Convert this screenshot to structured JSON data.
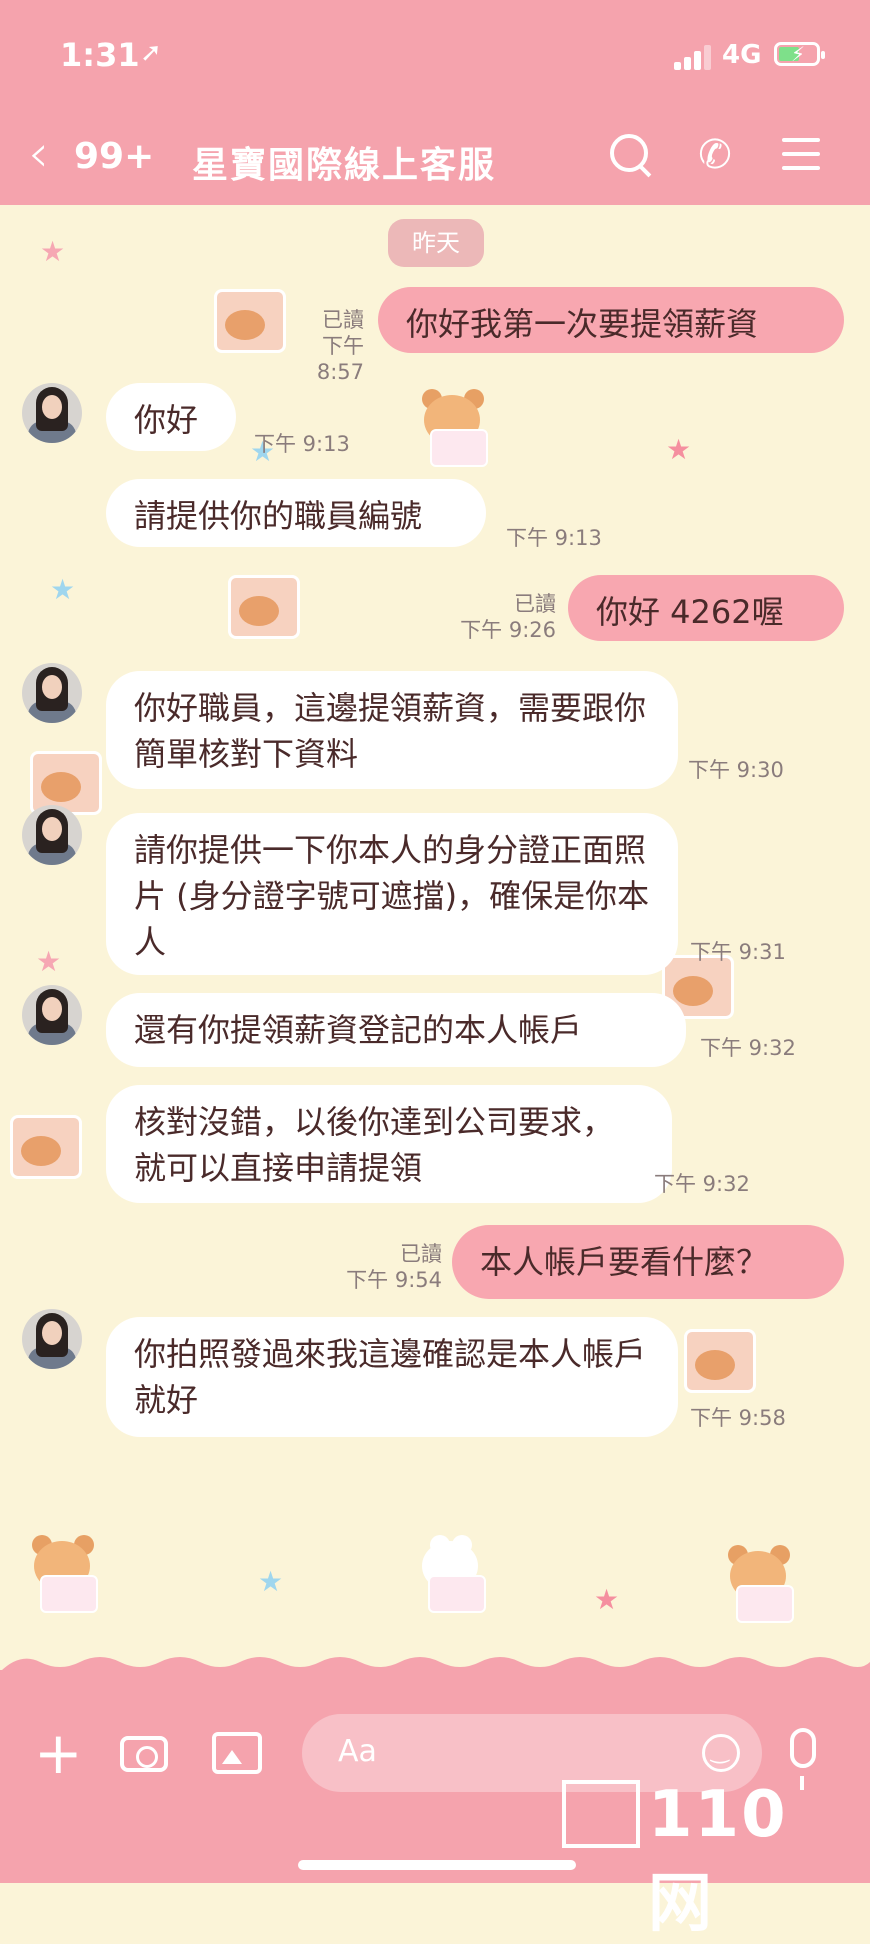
{
  "status_bar": {
    "time": "1:31",
    "location_glyph": "➚",
    "network": "4G",
    "battery_glyph": "⚡"
  },
  "header": {
    "back_glyph": "‹",
    "unread_count": "99+",
    "title": "星寶國際線上客服",
    "phone_glyph": "✆"
  },
  "chat": {
    "date_chip": "昨天",
    "messages": [
      {
        "from": "me",
        "text": "你好我第一次要提領薪資",
        "read": "已讀",
        "time": "下午 8:57"
      },
      {
        "from": "other",
        "text": "你好",
        "time": "下午 9:13"
      },
      {
        "from": "other",
        "text": "請提供你的職員編號",
        "time": "下午 9:13"
      },
      {
        "from": "me",
        "text": "你好 4262喔",
        "read": "已讀",
        "time": "下午 9:26"
      },
      {
        "from": "other",
        "text": "你好職員，這邊提領薪資，需要跟你簡單核對下資料",
        "time": "下午 9:30"
      },
      {
        "from": "other",
        "text": "請你提供一下你本人的身分證正面照片 (身分證字號可遮擋)，確保是你本人",
        "time": "下午 9:31"
      },
      {
        "from": "other",
        "text": "還有你提領薪資登記的本人帳戶",
        "time": "下午 9:32"
      },
      {
        "from": "other",
        "text": "核對沒錯，以後你達到公司要求，就可以直接申請提領",
        "time": "下午 9:32"
      },
      {
        "from": "me",
        "text": "本人帳戶要看什麼？",
        "read": "已讀",
        "time": "下午 9:54"
      },
      {
        "from": "other",
        "text": "你拍照發過來我這邊確認是本人帳戶就好",
        "time": "下午 9:58"
      }
    ]
  },
  "input": {
    "placeholder": "Aa"
  },
  "watermark": {
    "text": "110网"
  }
}
